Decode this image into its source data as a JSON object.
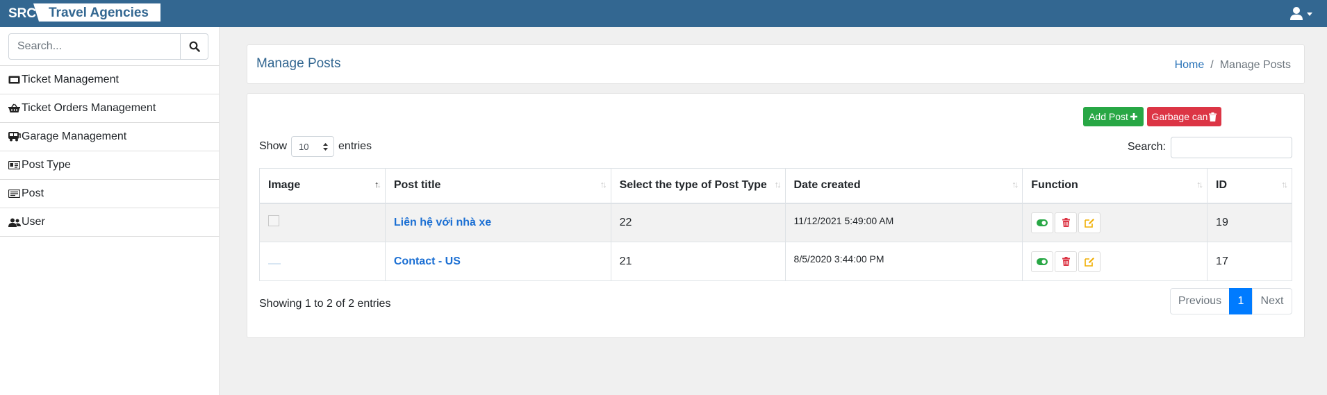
{
  "brand": {
    "short": "SRC",
    "name": "Travel Agencies"
  },
  "topbar": {
    "user_icon": "user-icon"
  },
  "sidebar": {
    "search_placeholder": "Search...",
    "items": [
      {
        "label": "Ticket Management",
        "icon": "ticket-icon"
      },
      {
        "label": "Ticket Orders Management",
        "icon": "basket-icon"
      },
      {
        "label": "Garage Management",
        "icon": "bus-icon"
      },
      {
        "label": "Post Type",
        "icon": "id-card-icon"
      },
      {
        "label": "Post",
        "icon": "post-card-icon"
      },
      {
        "label": "User",
        "icon": "users-icon"
      }
    ]
  },
  "header": {
    "title": "Manage Posts",
    "breadcrumb": {
      "home": "Home",
      "separator": "/",
      "current": "Manage Posts"
    }
  },
  "toolbar": {
    "add_label": "Add Post",
    "garbage_label": "Garbage can"
  },
  "table_controls": {
    "show_label": "Show",
    "entries_label": "entries",
    "page_length": "10",
    "search_label": "Search:",
    "search_value": ""
  },
  "table": {
    "columns": [
      "Image",
      "Post title",
      "Select the type of Post Type",
      "Date created",
      "Function",
      "ID"
    ],
    "rows": [
      {
        "title": "Liên hệ với nhà xe",
        "type": "22",
        "date": "11/12/2021 5:49:00 AM",
        "id": "19"
      },
      {
        "title": "Contact - US",
        "type": "21",
        "date": "8/5/2020 3:44:00 PM",
        "id": "17"
      }
    ]
  },
  "footer": {
    "info": "Showing 1 to 2 of 2 entries",
    "pagination": {
      "previous": "Previous",
      "current": "1",
      "next": "Next"
    }
  },
  "colors": {
    "topbar": "#336791",
    "success": "#28a745",
    "danger": "#dc3545",
    "warning": "#ffc107",
    "primary": "#007bff"
  }
}
